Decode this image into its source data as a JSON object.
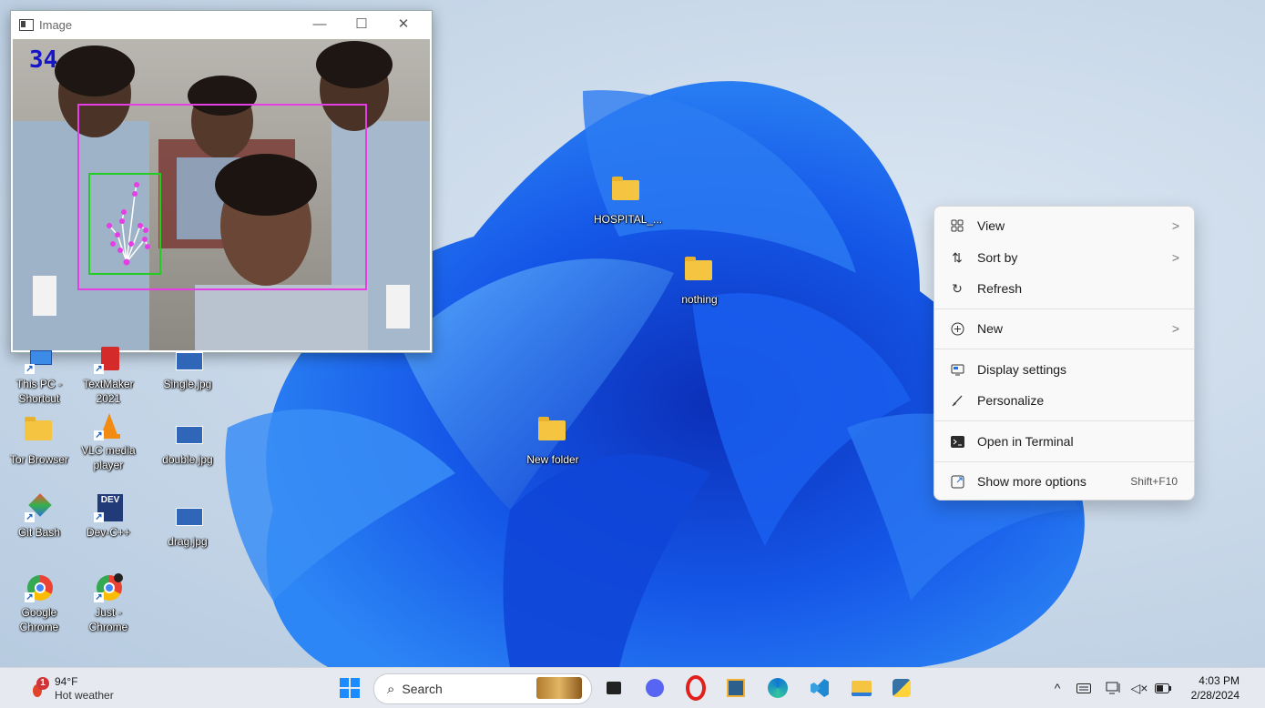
{
  "camera_window": {
    "title": "Image",
    "frame_counter": "34",
    "controls": {
      "minimize": "—",
      "maximize": "☐",
      "close": "✕"
    }
  },
  "desktop_icons": [
    {
      "label": "HOSPITAL_...",
      "kind": "folder"
    },
    {
      "label": "nothing",
      "kind": "folder"
    },
    {
      "label": "New folder",
      "kind": "folder"
    },
    {
      "label": "This PC - Shortcut",
      "kind": "this-pc"
    },
    {
      "label": "TextMaker 2021",
      "kind": "textmaker"
    },
    {
      "label": "Single.jpg",
      "kind": "image"
    },
    {
      "label": "Tor Browser",
      "kind": "folder"
    },
    {
      "label": "VLC media player",
      "kind": "vlc"
    },
    {
      "label": "double.jpg",
      "kind": "image"
    },
    {
      "label": "Git Bash",
      "kind": "git"
    },
    {
      "label": "Dev-C++",
      "kind": "devcpp"
    },
    {
      "label": "drag.jpg",
      "kind": "image"
    },
    {
      "label": "Google Chrome",
      "kind": "chrome"
    },
    {
      "label": "Just - Chrome",
      "kind": "chrome-profile"
    }
  ],
  "context_menu": {
    "items": [
      {
        "label": "View",
        "icon": "grid-view-icon",
        "submenu": true
      },
      {
        "label": "Sort by",
        "icon": "sort-arrows-icon",
        "submenu": true
      },
      {
        "label": "Refresh",
        "icon": "refresh-icon",
        "submenu": false
      },
      {
        "label": "New",
        "icon": "plus-circle-icon",
        "submenu": true
      },
      {
        "label": "Display settings",
        "icon": "display-icon",
        "submenu": false
      },
      {
        "label": "Personalize",
        "icon": "brush-icon",
        "submenu": false
      },
      {
        "label": "Open in Terminal",
        "icon": "terminal-icon",
        "submenu": false
      },
      {
        "label": "Show more options",
        "icon": "expand-icon",
        "submenu": false,
        "shortcut": "Shift+F10"
      }
    ]
  },
  "taskbar": {
    "weather": {
      "temp": "94°F",
      "condition": "Hot weather",
      "badge": "1"
    },
    "search_placeholder": "Search",
    "clock": {
      "time": "4:03 PM",
      "date": "2/28/2024"
    },
    "pinned_apps": [
      "start-icon",
      "search",
      "game-icon",
      "task-view-icon",
      "meet-icon",
      "opera-icon",
      "app-icon",
      "edge-icon",
      "vscode-icon",
      "file-explorer-icon",
      "python-icon"
    ]
  },
  "colors": {
    "accent": "#0067c0",
    "detection_box_person": "#e53ee5",
    "detection_box_hand": "#22cc22",
    "frame_counter": "#1616c8"
  }
}
